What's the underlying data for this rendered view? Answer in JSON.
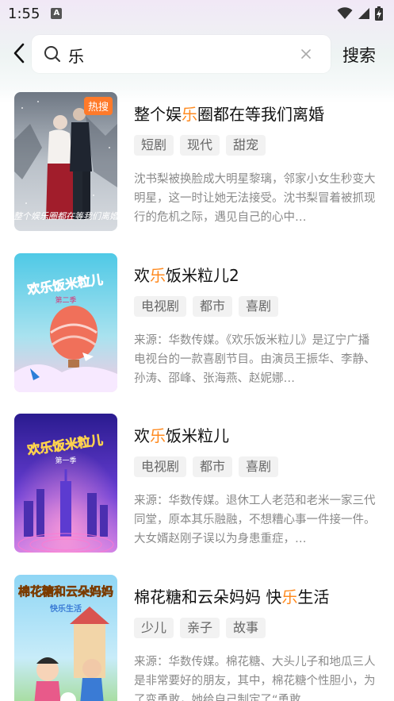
{
  "status_bar": {
    "time": "1:55",
    "notification_icon": "A"
  },
  "header": {
    "back_icon": "chevron-left-icon",
    "search_query": "乐",
    "search_button_label": "搜索"
  },
  "results": [
    {
      "title_before": "整个娱",
      "title_highlight": "乐",
      "title_after": "圈都在等我们离婚",
      "badge": "热搜",
      "tags": [
        "短剧",
        "现代",
        "甜宠"
      ],
      "description": "沈书梨被换脸成大明星黎璃，邻家小女生秒变大明星，这一时让她无法接受。沈书梨冒着被抓现行的危机之际，遇见自己的心中…",
      "poster_caption": "整个娱乐圈都在等我们离婚"
    },
    {
      "title_before": "欢",
      "title_highlight": "乐",
      "title_after": "饭米粒儿2",
      "badge": "",
      "tags": [
        "电视剧",
        "都市",
        "喜剧"
      ],
      "description": "来源：华数传媒。《欢乐饭米粒儿》是辽宁广播电视台的一款喜剧节目。由演员王振华、李静、孙涛、邵峰、张海燕、赵妮娜…",
      "poster_caption": "欢乐饭米粒儿",
      "poster_sub": "第二季"
    },
    {
      "title_before": "欢",
      "title_highlight": "乐",
      "title_after": "饭米粒儿",
      "badge": "",
      "tags": [
        "电视剧",
        "都市",
        "喜剧"
      ],
      "description": "来源：华数传媒。退休工人老范和老米一家三代同堂，原本其乐融融，不想糟心事一件接一件。大女婿赵刚子误以为身患重症，…",
      "poster_caption": "欢乐饭米粒儿",
      "poster_sub": "第一季"
    },
    {
      "title_before": "棉花糖和云朵妈妈 快",
      "title_highlight": "乐",
      "title_after": "生活",
      "badge": "",
      "tags": [
        "少儿",
        "亲子",
        "故事"
      ],
      "description": "来源：华数传媒。棉花糖、大头儿子和地瓜三人是非常要好的朋友，其中，棉花糖个性胆小，为了变勇敢，她给自己制定了“勇敢…",
      "poster_caption": "棉花糖和云朵妈妈",
      "poster_sub": "快乐生活"
    }
  ],
  "colors": {
    "highlight": "#ff8a1f",
    "badge": "#ff7a2a"
  }
}
